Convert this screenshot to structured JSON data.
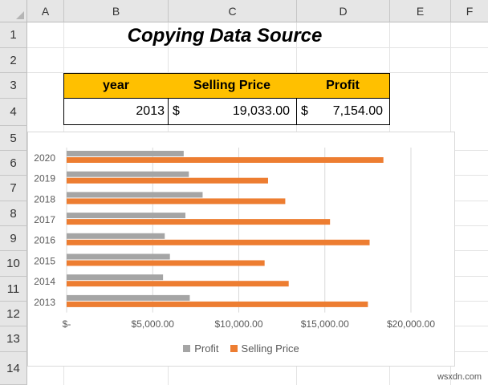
{
  "columns": [
    "A",
    "B",
    "C",
    "D",
    "E",
    "F"
  ],
  "rows": [
    "1",
    "2",
    "3",
    "4",
    "5",
    "6",
    "7",
    "8",
    "9",
    "10",
    "11",
    "12",
    "13",
    "14"
  ],
  "title": "Copying Data Source",
  "table": {
    "headers": [
      "year",
      "Selling Price",
      "Profit"
    ],
    "row": {
      "year": "2013",
      "price_currency": "$",
      "price": "19,033.00",
      "profit_currency": "$",
      "profit": "7,154.00"
    }
  },
  "chart_data": {
    "type": "bar",
    "orientation": "horizontal",
    "categories": [
      "2013",
      "2014",
      "2015",
      "2016",
      "2017",
      "2018",
      "2019",
      "2020"
    ],
    "series": [
      {
        "name": "Profit",
        "color": "#a5a5a5",
        "values": [
          7154,
          5600,
          6000,
          5700,
          6900,
          7900,
          7100,
          6800
        ]
      },
      {
        "name": "Selling Price",
        "color": "#ed7d31",
        "values": [
          17500,
          12900,
          11500,
          17600,
          15300,
          12700,
          11700,
          18400
        ]
      }
    ],
    "xticks": [
      "$-",
      "$5,000.00",
      "$10,000.00",
      "$15,000.00",
      "$20,000.00"
    ],
    "xlim": [
      0,
      20000
    ],
    "grid": true,
    "legend": "bottom"
  },
  "watermark": "wsxdn.com"
}
